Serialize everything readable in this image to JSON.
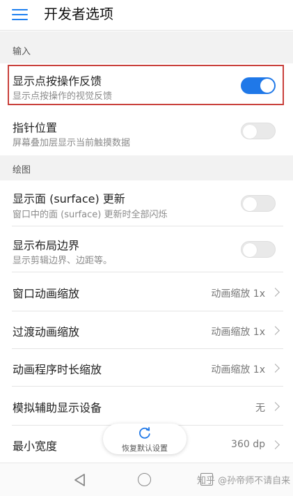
{
  "appbar": {
    "title": "开发者选项",
    "menu_icon": "menu-icon"
  },
  "sections": {
    "input": "输入",
    "drawing": "绘图"
  },
  "rows": {
    "show_taps": {
      "title": "显示点按操作反馈",
      "subtitle": "显示点按操作的视觉反馈",
      "toggle": true
    },
    "pointer_location": {
      "title": "指针位置",
      "subtitle": "屏幕叠加层显示当前触摸数据",
      "toggle": false
    },
    "surface_updates": {
      "title": "显示面 (surface) 更新",
      "subtitle": "窗口中的面 (surface) 更新时全部闪烁",
      "toggle": false
    },
    "layout_bounds": {
      "title": "显示布局边界",
      "subtitle": "显示剪辑边界、边距等。",
      "toggle": false
    },
    "window_anim": {
      "title": "窗口动画缩放",
      "value": "动画缩放 1x"
    },
    "transition_anim": {
      "title": "过渡动画缩放",
      "value": "动画缩放 1x"
    },
    "animator_duration": {
      "title": "动画程序时长缩放",
      "value": "动画缩放 1x"
    },
    "secondary_display": {
      "title": "模拟辅助显示设备",
      "value": "无"
    },
    "smallest_width": {
      "title": "最小宽度",
      "value": "360 dp"
    }
  },
  "restore_button": {
    "label": "恢复默认设置"
  },
  "watermark": "知乎 @孙帝师不请自来",
  "colors": {
    "accent": "#1f78e8",
    "highlight": "#c9403b",
    "section_bg": "#f2f2f2"
  }
}
